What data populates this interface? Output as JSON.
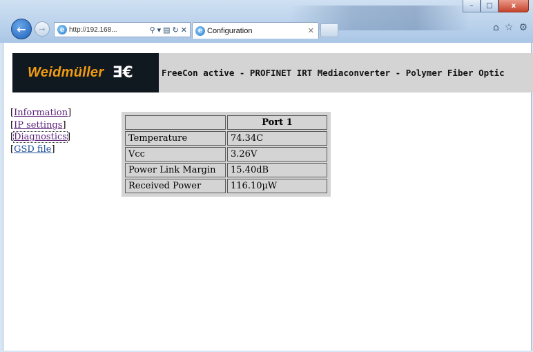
{
  "browser": {
    "address": "http://192.168...",
    "tab_title": "Configuration",
    "icons": [
      "back-arrow-icon",
      "forward-arrow-icon",
      "search-icon",
      "compat-icon",
      "refresh-icon",
      "stop-icon",
      "home-icon",
      "favorites-star-icon",
      "settings-gear-icon"
    ],
    "window_buttons": {
      "minimize": "–",
      "maximize": "□",
      "close": "x"
    }
  },
  "header": {
    "logo_text": "Weidmüller",
    "logo_mark": "Ǝ€",
    "banner": "FreeCon active - PROFINET IRT Mediaconverter - Polymer Fiber Optic"
  },
  "menu": [
    {
      "label": "Information"
    },
    {
      "label": "IP settings"
    },
    {
      "label": "Diagnostics"
    },
    {
      "label": "GSD file"
    }
  ],
  "table": {
    "header": [
      "",
      "Port 1"
    ],
    "rows": [
      [
        "Temperature",
        "74.34C"
      ],
      [
        "Vcc",
        "3.26V"
      ],
      [
        "Power Link Margin",
        "15.40dB"
      ],
      [
        "Received Power",
        "116.10µW"
      ]
    ]
  },
  "colors": {
    "logo_orange": "#f29c10",
    "logo_bg": "#101820",
    "banner_bg": "#d4d4d4",
    "visited_link": "#5a1f7a",
    "link": "#1e4f9a"
  }
}
